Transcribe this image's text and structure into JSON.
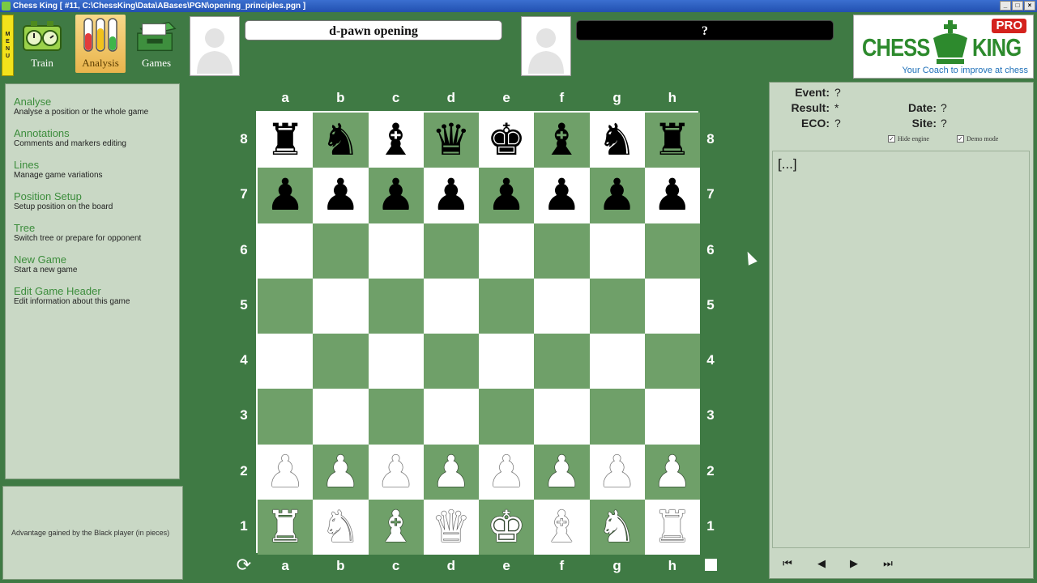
{
  "window": {
    "title": "Chess King [ #11, C:\\ChessKing\\Data\\ABases\\PGN\\opening_principles.pgn ]"
  },
  "toolbar": {
    "menu_label": "MENU",
    "tools": [
      {
        "label": "Train"
      },
      {
        "label": "Analysis"
      },
      {
        "label": "Games"
      }
    ]
  },
  "players": {
    "white": "d-pawn opening",
    "black": "?"
  },
  "logo": {
    "pro": "PRO",
    "chess": "CHESS",
    "king": "KING",
    "tagline": "Your Coach to improve at chess"
  },
  "left_menu": [
    {
      "title": "Analyse",
      "desc": "Analyse a position or the whole game"
    },
    {
      "title": "Annotations",
      "desc": "Comments and markers editing"
    },
    {
      "title": "Lines",
      "desc": "Manage game variations"
    },
    {
      "title": "Position Setup",
      "desc": "Setup position on the board"
    },
    {
      "title": "Tree",
      "desc": "Switch tree or prepare for opponent"
    },
    {
      "title": "New Game",
      "desc": "Start a new game"
    },
    {
      "title": "Edit Game Header",
      "desc": "Edit information about this game"
    }
  ],
  "advantage_text": "Advantage gained by the Black player (in pieces)",
  "board": {
    "files": [
      "a",
      "b",
      "c",
      "d",
      "e",
      "f",
      "g",
      "h"
    ],
    "ranks": [
      "8",
      "7",
      "6",
      "5",
      "4",
      "3",
      "2",
      "1"
    ],
    "rows": [
      [
        "r",
        "n",
        "b",
        "q",
        "k",
        "b",
        "n",
        "r"
      ],
      [
        "p",
        "p",
        "p",
        "p",
        "p",
        "p",
        "p",
        "p"
      ],
      [
        "",
        "",
        "",
        "",
        "",
        "",
        "",
        ""
      ],
      [
        "",
        "",
        "",
        "",
        "",
        "",
        "",
        ""
      ],
      [
        "",
        "",
        "",
        "",
        "",
        "",
        "",
        ""
      ],
      [
        "",
        "",
        "",
        "",
        "",
        "",
        "",
        ""
      ],
      [
        "P",
        "P",
        "P",
        "P",
        "P",
        "P",
        "P",
        "P"
      ],
      [
        "R",
        "N",
        "B",
        "Q",
        "K",
        "B",
        "N",
        "R"
      ]
    ]
  },
  "game_header": {
    "event_label": "Event:",
    "event": "?",
    "result_label": "Result:",
    "result": "*",
    "eco_label": "ECO:",
    "eco": "?",
    "date_label": "Date:",
    "date": "?",
    "site_label": "Site:",
    "site": "?",
    "hide_engine": "Hide engine",
    "demo_mode": "Demo mode"
  },
  "notation_text": "[...]",
  "colors": {
    "light_square": "#ffffff",
    "dark_square": "#6fa069",
    "background": "#3f7a44"
  }
}
